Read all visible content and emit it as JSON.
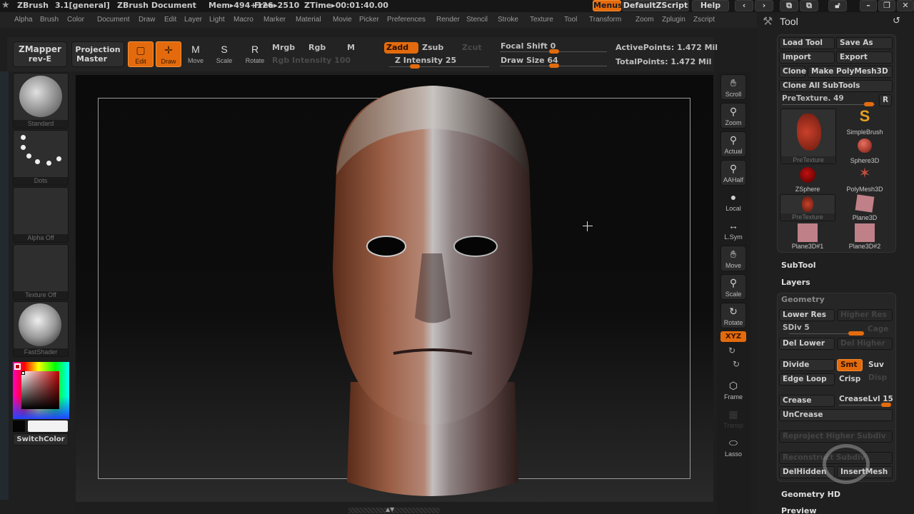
{
  "titlebar": {
    "app": "ZBrush",
    "version": "3.1[general]",
    "document": "ZBrush Document",
    "mem": "Mem▸494+126",
    "free": "Free▸2510",
    "ztime": "ZTime▸00:01:40.00",
    "buttons": {
      "menus": "Menus",
      "script": "DefaultZScript",
      "help": "Help"
    },
    "icons": [
      "scroll-left-icon",
      "scroll-right-icon",
      "palette-left-icon",
      "palette-right-icon",
      "lock-icon",
      "minimize-icon",
      "restore-icon",
      "close-icon"
    ]
  },
  "menubar": [
    "Alpha",
    "Brush",
    "Color",
    "Document",
    "Draw",
    "Edit",
    "Layer",
    "Light",
    "Macro",
    "Marker",
    "Material",
    "Movie",
    "Picker",
    "Preferences",
    "Render",
    "Stencil",
    "Stroke",
    "Texture",
    "Tool",
    "Transform",
    "Zoom",
    "Zplugin",
    "Zscript"
  ],
  "shelf": {
    "zmapper": [
      "ZMapper",
      "rev-E"
    ],
    "projection": [
      "Projection",
      "Master"
    ],
    "tools": [
      {
        "label": "Edit",
        "active": true
      },
      {
        "label": "Draw",
        "active": true
      },
      {
        "label": "Move",
        "active": false
      },
      {
        "label": "Scale",
        "active": false
      },
      {
        "label": "Rotate",
        "active": false
      }
    ],
    "mrgb": "Mrgb",
    "rgb": "Rgb",
    "m": "M",
    "rgb_intensity": "Rgb Intensity 100",
    "zadd": "Zadd",
    "zsub": "Zsub",
    "zcut": "Zcut",
    "z_intensity": "Z Intensity 25",
    "focal_shift": "Focal Shift 0",
    "draw_size": "Draw Size 64",
    "active_points": "ActivePoints: 1.472 Mil",
    "total_points": "TotalPoints: 1.472 Mil"
  },
  "left": {
    "brush": "Standard",
    "stroke": "Dots",
    "alpha": "Alpha Off",
    "texture": "Texture Off",
    "material": "FastShader",
    "switch_color": "SwitchColor",
    "primary_color": "#000000",
    "secondary_color": "#f2f2f2"
  },
  "dock": [
    {
      "label": "Scroll",
      "icon": "hand-icon"
    },
    {
      "label": "Zoom",
      "icon": "magnifier-icon"
    },
    {
      "label": "Actual",
      "icon": "actual-size-icon"
    },
    {
      "label": "AAHalf",
      "icon": "aahalf-icon"
    },
    {
      "label": "Local",
      "icon": "local-icon"
    },
    {
      "label": "L.Sym",
      "icon": "symmetry-icon"
    },
    {
      "label": "Move",
      "icon": "move-icon"
    },
    {
      "label": "Scale",
      "icon": "scale-icon"
    },
    {
      "label": "Rotate",
      "icon": "rotate-icon"
    },
    {
      "label": "Frame",
      "icon": "frame-icon"
    },
    {
      "label": "Transp",
      "icon": "transparency-icon"
    },
    {
      "label": "Lasso",
      "icon": "lasso-icon"
    }
  ],
  "dock_xyz": "XYZ",
  "tool_panel": {
    "title": "Tool",
    "load_tool": "Load Tool",
    "save_as": "Save As",
    "import": "Import",
    "export": "Export",
    "clone": "Clone",
    "make_polymesh": "Make PolyMesh3D",
    "clone_all": "Clone All SubTools",
    "pretexture_slider": "PreTexture. 49",
    "r": "R",
    "thumbs": [
      "PreTexture",
      "SimpleBrush",
      "Sphere3D",
      "ZSphere",
      "PolyMesh3D",
      "PreTexture",
      "Plane3D",
      "Plane3D#1",
      "Plane3D#2"
    ],
    "subtool": "SubTool",
    "layers": "Layers",
    "geometry": {
      "title": "Geometry",
      "lower_res": "Lower Res",
      "higher_res": "Higher Res",
      "sdiv": "SDiv 5",
      "cage": "Cage",
      "del_lower": "Del Lower",
      "del_higher": "Del Higher",
      "divide": "Divide",
      "smt": "Smt",
      "suv": "Suv",
      "edge_loop": "Edge Loop",
      "crisp": "Crisp",
      "disp": "Disp",
      "crease": "Crease",
      "crease_lvl": "CreaseLvl 15",
      "uncrease": "UnCrease",
      "reproject": "Reproject Higher Subdiv",
      "reconstruct": "Reconstruct Subdiv",
      "del_hidden": "DelHidden",
      "insert_mesh": "InsertMesh"
    },
    "geometry_hd": "Geometry HD",
    "preview": "Preview"
  }
}
